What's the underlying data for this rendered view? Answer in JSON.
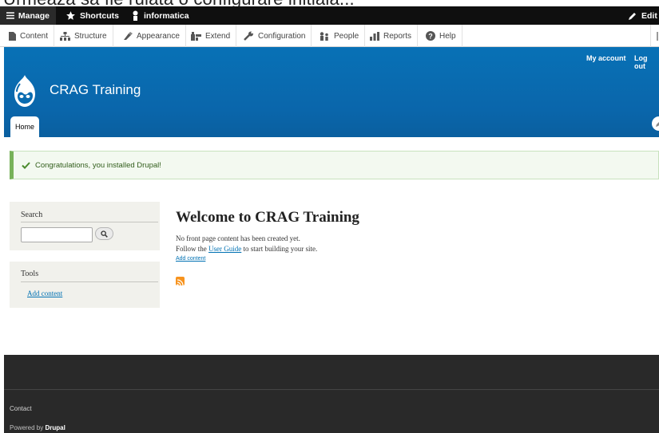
{
  "caption": "Urmeaza sa fie rulata o configurare initiala...",
  "toolbar": {
    "manage": "Manage",
    "shortcuts": "Shortcuts",
    "user": "informatica",
    "edit": "Edit"
  },
  "admin_menu": {
    "items": [
      {
        "label": "Content",
        "icon": "content-icon"
      },
      {
        "label": "Structure",
        "icon": "structure-icon"
      },
      {
        "label": "Appearance",
        "icon": "appearance-icon"
      },
      {
        "label": "Extend",
        "icon": "extend-icon"
      },
      {
        "label": "Configuration",
        "icon": "configuration-icon"
      },
      {
        "label": "People",
        "icon": "people-icon"
      },
      {
        "label": "Reports",
        "icon": "reports-icon"
      },
      {
        "label": "Help",
        "icon": "help-icon"
      }
    ]
  },
  "header": {
    "site_name": "CRAG Training",
    "my_account": "My account",
    "log_out": "Log out",
    "home_tab": "Home"
  },
  "status": {
    "message": "Congratulations, you installed Drupal!"
  },
  "sidebar": {
    "search_title": "Search",
    "search_value": "",
    "tools_title": "Tools",
    "tools_link": "Add content"
  },
  "main": {
    "title": "Welcome to CRAG Training",
    "line1": "No front page content has been created yet.",
    "line2_pre": "Follow the ",
    "line2_link": "User Guide",
    "line2_post": " to start building your site.",
    "add_content": "Add content"
  },
  "footer": {
    "contact": "Contact",
    "powered_pre": "Powered by ",
    "powered_link": "Drupal"
  },
  "colors": {
    "header_blue": "#0a6bb0",
    "status_green": "#77b259",
    "link_blue": "#0071b3",
    "footer_dark": "#292929"
  }
}
